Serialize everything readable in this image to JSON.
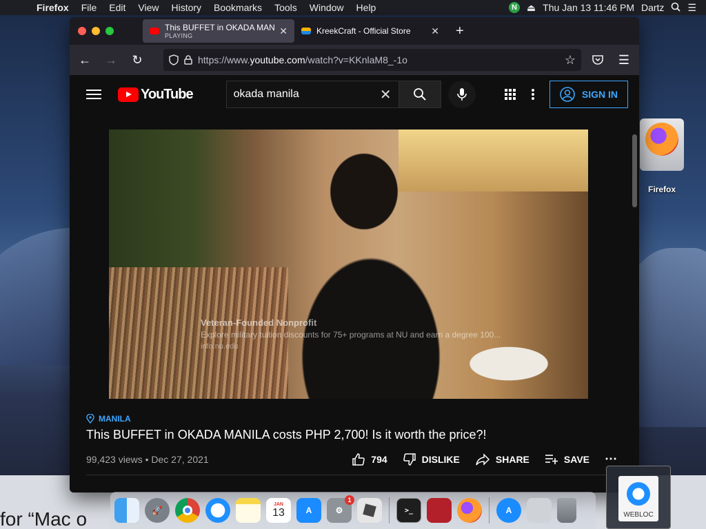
{
  "menubar": {
    "app": "Firefox",
    "items": [
      "File",
      "Edit",
      "View",
      "History",
      "Bookmarks",
      "Tools",
      "Window",
      "Help"
    ],
    "n_badge": "N",
    "clock": "Thu Jan 13  11:46 PM",
    "user": "Dartz"
  },
  "desktop": {
    "icon_label": "Firefox",
    "partial_text": "for “Mac o"
  },
  "browser": {
    "tabs": [
      {
        "title": "This BUFFET in OKADA MANILA",
        "subtitle": "PLAYING",
        "active": true
      },
      {
        "title": "KreekCraft - Official Store",
        "subtitle": "",
        "active": false
      }
    ],
    "url": {
      "prefix": "https://www.",
      "host": "youtube.com",
      "path": "/watch?v=KKnlaM8_-1o"
    }
  },
  "youtube": {
    "logo_text": "YouTube",
    "search_value": "okada manila",
    "signin_label": "SIGN IN",
    "ad": {
      "headline": "Veteran-Founded Nonprofit",
      "body": "Explore military tuition discounts for 75+ programs at NU and earn a degree 100...",
      "url": "info.nu.edu"
    },
    "video": {
      "location": "MANILA",
      "title": "This BUFFET in OKADA MANILA costs PHP 2,700! Is it worth the price?!",
      "stats": "99,423 views • Dec 27, 2021",
      "likes": "794",
      "dislike_label": "DISLIKE",
      "share_label": "SHARE",
      "save_label": "SAVE"
    }
  },
  "dock": {
    "calendar_month": "JAN",
    "calendar_day": "13",
    "settings_badge": "1",
    "webloc_label": "WEBLOC"
  },
  "colors": {
    "yt_red": "#ff0000",
    "link_blue": "#3ea6ff",
    "yt_bg": "#0f0f0f"
  }
}
